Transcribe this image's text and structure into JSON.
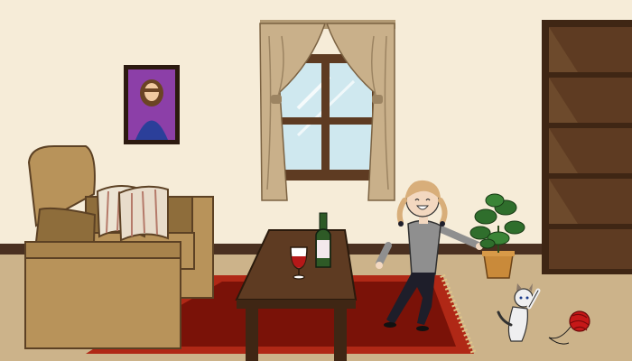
{
  "scene": {
    "name": "living-room",
    "objects": [
      "wall",
      "floor",
      "framed-portrait",
      "window",
      "curtains",
      "bookshelf",
      "armchair",
      "cushions",
      "rug",
      "coffee-table",
      "wine-bottle",
      "wine-glass",
      "girl",
      "potted-plant",
      "cat",
      "yarn-ball"
    ]
  },
  "colors": {
    "wall": "#f6ecd8",
    "floor": "#ccb38a",
    "baseboard": "#4a3020",
    "wood": "#5e3b22",
    "wood_dark": "#3f2614",
    "sofa": "#b8935a",
    "sofa_dark": "#8e6d3b",
    "rug": "#b02816",
    "rug_inner": "#7a1208",
    "curtain": "#c9b08a",
    "sky": "#cfe8ef",
    "portrait_bg": "#8c3fa8",
    "bottle": "#2e5a26",
    "wine": "#b51818",
    "girl_shirt": "#8f8f8f",
    "girl_pants": "#1e1e2a",
    "hair": "#d8ae7a",
    "plant": "#2f6e2c",
    "pot": "#c98a3a",
    "cat": "#efeff0",
    "yarn": "#c61818"
  }
}
